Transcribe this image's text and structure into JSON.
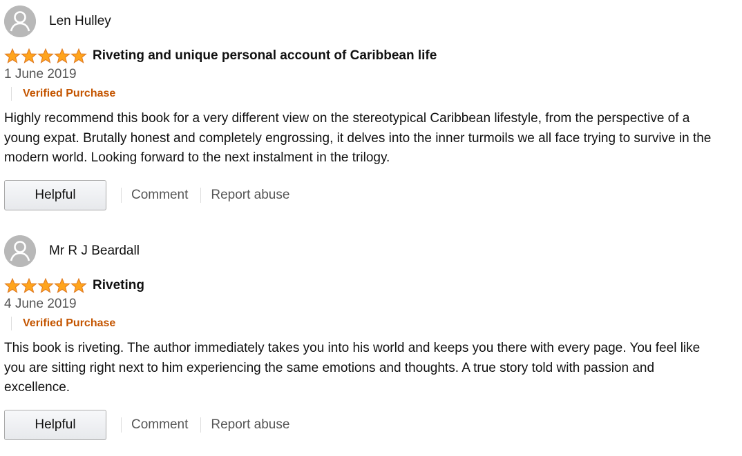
{
  "reviews": [
    {
      "author": "Len Hulley",
      "rating": 5,
      "rating_max": 5,
      "title": "Riveting and unique personal account of Caribbean life",
      "date": "1 June 2019",
      "badge": "Verified Purchase",
      "body": "Highly recommend this book for a very different view on the stereotypical Caribbean lifestyle, from the perspective of a young expat. Brutally honest and completely engrossing, it delves into the inner turmoils we all face trying to survive in the modern world. Looking forward to the next instalment in the trilogy.",
      "helpful_label": "Helpful",
      "comment_label": "Comment",
      "report_label": "Report abuse"
    },
    {
      "author": "Mr R J Beardall",
      "rating": 5,
      "rating_max": 5,
      "title": "Riveting",
      "date": "4 June 2019",
      "badge": "Verified Purchase",
      "body": "This book is riveting. The author immediately takes you into his world and keeps you there with every page. You feel like you are sitting right next to him experiencing the same emotions and thoughts. A true story told with passion and excellence.",
      "helpful_label": "Helpful",
      "comment_label": "Comment",
      "report_label": "Report abuse"
    }
  ],
  "colors": {
    "star_fill": "#ffa41c",
    "star_stroke": "#de7921",
    "verified": "#c45500",
    "link": "#555555",
    "avatar_bg": "#b8b8b8"
  },
  "icons": {
    "avatar": "default-user-avatar-icon",
    "star": "star-filled-icon"
  }
}
